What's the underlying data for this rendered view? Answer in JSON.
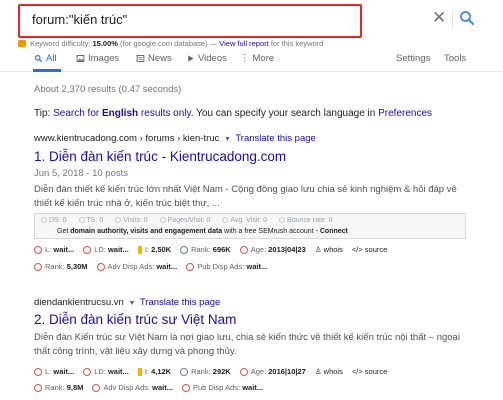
{
  "search": {
    "query": "forum:\"kiến trúc\"",
    "clear": "✕"
  },
  "keyword_line": {
    "prefix": "Keyword difficulty:",
    "percent": "15.00%",
    "suffix": "(for google.com database) —",
    "link": "View full report",
    "tail": "for this keyword"
  },
  "tabs": {
    "all": "All",
    "images": "Images",
    "news": "News",
    "videos": "Videos",
    "more": "More",
    "settings": "Settings",
    "tools": "Tools"
  },
  "stats": "About 2,370 results (0.47 seconds)",
  "tip": {
    "prefix": "Tip:",
    "link1_a": "Search for",
    "link1_b": "English",
    "link1_c": "results only",
    "middle": ". You can specify your search language in",
    "link2": "Preferences"
  },
  "results": [
    {
      "url": "www.kientrucadong.com › forums › kien-truc",
      "translate": "Translate this page",
      "title": "1. Diễn đàn kiến trúc - Kientrucadong.com",
      "meta": "Jun 5, 2018 - 10 posts",
      "snippet": "Diễn đàn thiết kế kiến trúc lớn nhất Việt Nam - Cộng đồng giao lưu chia sẻ kinh nghiệm & hỏi đáp về thiết kế kiến trúc nhà ở, kiến trúc biệt thự, ...",
      "seo_row1": [
        "DS: 0",
        "TS: 0",
        "Visits: 0",
        "Pages/Visit: 0",
        "Avg. Visit: 0",
        "Bounce rate: 0"
      ],
      "seo_row2_a": "Get",
      "seo_row2_b": "domain authority, visits and engagement data",
      "seo_row2_c": "with a free SEMrush account -",
      "seo_row2_d": "Connect",
      "metrics1": [
        "L:",
        "wait...",
        "LD:",
        "wait...",
        "I:",
        "2,50K",
        "Rank:",
        "696K",
        "Age:",
        "2013|04|23",
        "whois",
        "source"
      ],
      "metrics2": [
        "Rank:",
        "5,30M",
        "Adv Disp Ads:",
        "wait...",
        "Pub Disp Ads:",
        "wait..."
      ]
    },
    {
      "url": "diendankientrucsu.vn",
      "translate": "Translate this page",
      "title": "2. Diễn đàn kiến trúc sư Việt Nam",
      "snippet": "Diễn đàn Kiến trúc sư Việt Nam là nơi giao lưu, chia sẻ kiến thức về thiết kế kiến trúc nội thất – ngoại thất công trình, vật liệu xây dựng và phong thủy.",
      "metrics1": [
        "L:",
        "wait...",
        "LD:",
        "wait...",
        "I:",
        "4,12K",
        "Rank:",
        "292K",
        "Age:",
        "2016|10|27",
        "whois",
        "source"
      ],
      "metrics2": [
        "Rank:",
        "9,8M",
        "Adv Disp Ads:",
        "wait...",
        "Pub Disp Ads:",
        "wait..."
      ]
    }
  ],
  "colors": {
    "highlight": "#e8262a",
    "link": "#1a0dab",
    "accent": "#1a73e8"
  }
}
